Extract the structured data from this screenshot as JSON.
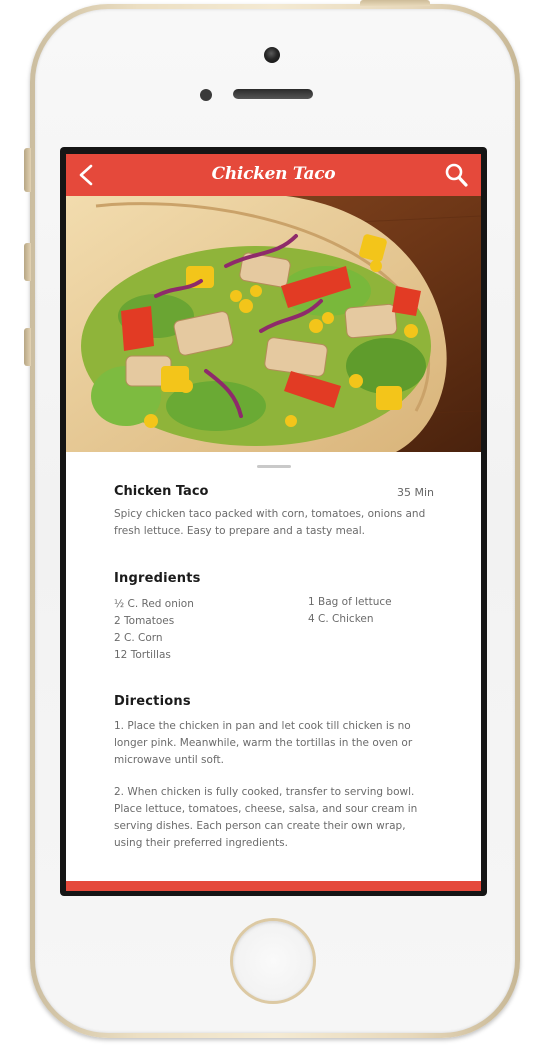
{
  "app_bar": {
    "title": "Chicken Taco",
    "color": "#e5493b"
  },
  "icons": [
    "back-arrow-icon",
    "search-icon",
    "camera-icon",
    "speaker-icon",
    "home-button-icon"
  ],
  "hero_image": {
    "subject": "chicken taco wrap"
  },
  "recipe": {
    "title": "Chicken Taco",
    "time": "35 Min",
    "description": "Spicy chicken taco packed with corn, tomatoes, onions and fresh lettuce. Easy to prepare and a tasty meal."
  },
  "ingredients": {
    "heading": "Ingredients",
    "left": [
      "½ C. Red onion",
      "2 Tomatoes",
      "2 C. Corn",
      "12 Tortillas"
    ],
    "right": [
      "1 Bag of lettuce",
      "4 C. Chicken"
    ]
  },
  "directions": {
    "heading": "Directions",
    "steps": [
      "1. Place the chicken in pan and let cook till chicken is no longer pink. Meanwhile, warm the tortillas in the oven or microwave until soft.",
      "2. When chicken is fully cooked, transfer to serving bowl. Place lettuce, tomatoes, cheese, salsa, and sour cream in serving dishes. Each person can create their own wrap, using their preferred ingredients."
    ]
  }
}
